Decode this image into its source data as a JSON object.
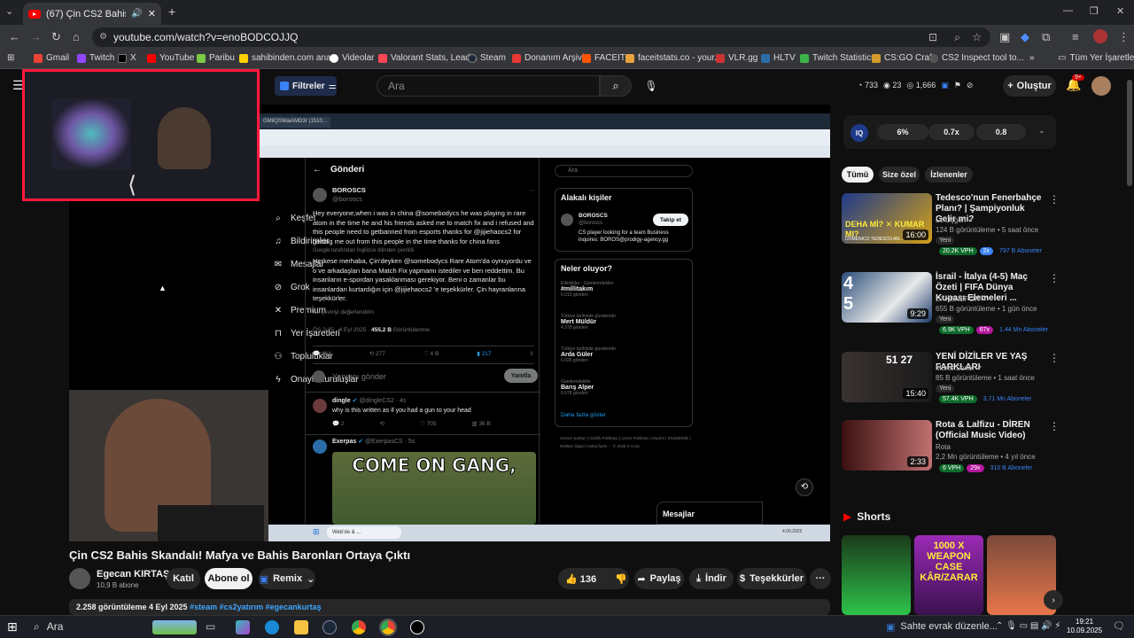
{
  "browser": {
    "tab_title": "(67) Çin CS2 Bahis Skandalı!",
    "url": "youtube.com/watch?v=enoBODCOJJQ",
    "bookmarks": [
      "Gmail",
      "Twitch",
      "X",
      "YouTube",
      "Paribu",
      "sahibinden.com ana...",
      "Videolar",
      "Valorant Stats, Lead...",
      "Steam",
      "Donanım Arşivi",
      "FACEIT",
      "faceitstats.co - your...",
      "VLR.gg",
      "HLTV",
      "Twitch Statistics",
      "CS:GO Craft",
      "CS2 Inspect tool to..."
    ],
    "all_bookmarks": "Tüm Yer İşaretleri"
  },
  "yt_header": {
    "filters": "Filtreler",
    "search_placeholder": "Ara",
    "stat_a": "733",
    "stat_b": "23",
    "stat_c": "1,666",
    "create": "Oluştur",
    "notif_count": "9+"
  },
  "video_content": {
    "twitter_nav": [
      "Keşfet",
      "Bildirimler",
      "Mesajlar",
      "Grok",
      "Premium",
      "Yer İşaretleri",
      "Topluluklar",
      "Onaylı Kuruluşlar"
    ],
    "inner_tabs": [
      "GMilQSWaiAMD3r (1510...",
      "X'te LycheeCS: \"(I) \"C\"...",
      "GMilljpaoAAXIoW (500×...",
      "X'te LycheeCS: \"(2) CS2...",
      "X'te wanarei: \"@LycheeCS...",
      "X'te BeB... \"@AlphaG..."
    ],
    "post_header": "Gönderi",
    "author": "BOROSCS",
    "handle": "@boroscs",
    "post_en": "Hey everyone,when i was in china @somebodycs he was playing in rare atom in the time he and his friends asked me to match fix and i refused and this people need to getbanned from esports thanks for @jijiehaocs2 for getting me out from this people in the time thanks for china fans",
    "translate_note": "Google tarafından İngilizce dilinden çevrildi",
    "post_tr": "Herkese merhaba, Çin'deyken @somebodycs Rare Atom'da oynuyordu ve o ve arkadaşları bana Match Fix yapmamı istediler ve ben reddettim. Bu insanların e-spordan yasaklanması gerekiyor. Beni o zamanlar bu insanlardan kurtardığın için @jijiehaocs2 'e teşekkürler. Çin hayranlarına teşekkürler.",
    "rate_translation": "Bu çeviriyi değerlendirin",
    "post_time": "ÖS 2:25 · 4 Eyl 2025 · ",
    "post_views": "455,2 B",
    "post_views_label": " Görüntülenme",
    "actions": [
      "864",
      "277",
      "4 B",
      "217"
    ],
    "reply_placeholder": "Yanıtını gönder",
    "reply_button": "Yanıtla",
    "reply1_author": "dingle",
    "reply1_handle": "@dingleCS2 · 4s",
    "reply1_text": "why is this written as if you had a gun to your head",
    "reply1_stats": [
      "2",
      "705",
      "36 B"
    ],
    "reply2_author": "Exerpas",
    "reply2_handle": "@ExerpasCS · 5s",
    "meme_text": "COME ON GANG,",
    "search_placeholder": "Ara",
    "related_title": "Alakalı kişiler",
    "related_name": "BOROSCS",
    "related_handle": "@boroscs",
    "related_bio": "CS player looking for a team Business inquires: BOROS@prodigy-agency.gg",
    "follow": "Takip et",
    "trending_title": "Neler oluyor?",
    "trending": [
      {
        "ctx": "Etkinlikler · Gündemdekiler",
        "name": "#millitakım",
        "count": "6.013 gönderi"
      },
      {
        "ctx": "Türkiye tarihinde gündemde",
        "name": "Mert Müldür",
        "count": "4.378 gönderi"
      },
      {
        "ctx": "Türkiye tarihinde gündemde",
        "name": "Arda Güler",
        "count": "6.026 gönderi"
      },
      {
        "ctx": "Gündemdekiler",
        "name": "Barış Alper",
        "count": "6.678 gönderi"
      }
    ],
    "show_more": "Daha fazla göster",
    "footer": "Hizmet Şartları | Gizlilik Politikası | Çerez Politikası | Imprint | Erişilebilirlik | Reklam bilgisi | Daha fazla ··· © 2025 X Corp.",
    "dm_label": "Mesajlar",
    "win_search": "Web'de & ...",
    "inner_clock": "4.09.2025"
  },
  "video_info": {
    "title": "Çin CS2 Bahis Skandalı! Mafya ve Bahis Baronları Ortaya Çıktı",
    "channel": "Egecan KIRTAŞ",
    "subs": "10,9 B abone",
    "join": "Katıl",
    "subscribe": "Abone ol",
    "remix": "Remix",
    "likes": "136",
    "share": "Paylaş",
    "download": "İndir",
    "thanks": "Teşekkürler",
    "views_date": "2.258 görüntüleme  4 Eyl 2025",
    "hashtags": "#steam #cs2yatırım #egecankurtaş"
  },
  "sidebar": {
    "stats": [
      "6%",
      "0.7x",
      "0.8"
    ],
    "chips": [
      "Tümü",
      "Size özel",
      "İzlenenler"
    ],
    "recs": [
      {
        "title": "Tedesco'nun Fenerbahçe Planı? | Şampiyonluk Gelir mi?",
        "channel": "L1 Üçgen",
        "meta": "124 B görüntüleme • 5 saat önce",
        "badge": "Yeni",
        "vph": "20.2K VPH",
        "mult": "2x",
        "subs": "797 B Aboneler",
        "duration": "16:00",
        "thumb_caption": "DOMENICO TEDESCO AN..."
      },
      {
        "title": "İsrail - İtalya (4-5) Maç Özeti | FIFA Dünya Kupası Elemeleri ...",
        "channel": "EXXENSPOR",
        "meta": "655 B görüntüleme • 1 gün önce",
        "badge": "Yeni",
        "vph": "6.9K VPH",
        "mult": "67x",
        "subs": "1.44 Mn Aboneler",
        "duration": "9:29",
        "thumb_caption": ""
      },
      {
        "title": "YENİ DİZİLER VE YAŞ FARKLARI",
        "channel": "Murat Soner",
        "meta": "85 B görüntüleme • 1 saat önce",
        "badge": "Yeni",
        "vph": "57.4K VPH",
        "mult": "",
        "subs": "3.71 Mn Aboneler",
        "duration": "15:40",
        "thumb_caption": "51  27"
      },
      {
        "title": "Rota & Lalfizu - DİREN (Official Music Video)",
        "channel": "Rota",
        "meta": "2,2 Mn görüntüleme • 4 yıl önce",
        "badge": "",
        "vph": "6 VPH",
        "mult": "29x",
        "subs": "310 B Aboneler",
        "duration": "2:33",
        "thumb_caption": ""
      }
    ],
    "shorts_title": "Shorts",
    "short_texts": [
      "1000 X WEAPON CASE KÂR/ZARAR"
    ]
  },
  "taskbar": {
    "search": "Ara",
    "news": "Sahte evrak düzenle...",
    "time": "19:21",
    "date": "10.09.2025"
  },
  "colors": {
    "accent_red": "#ff0000",
    "webcam_border": "#ff1a3c",
    "twitter_blue": "#1d9bf0",
    "vph_green": "#0e6b2b",
    "mult_pink": "#b5179e",
    "subs_blue": "#3b82f6"
  }
}
